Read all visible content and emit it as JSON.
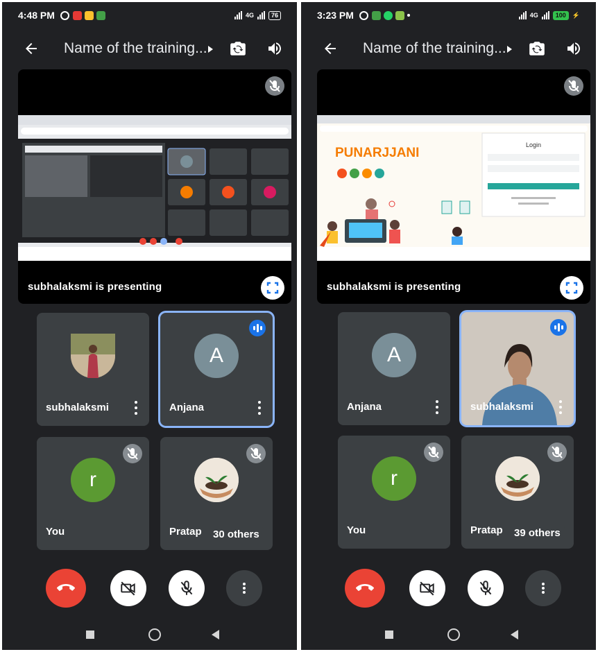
{
  "left": {
    "status": {
      "time": "4:48 PM",
      "network": "4G",
      "battery": "76"
    },
    "header": {
      "title": "Name of the training..."
    },
    "presentation": {
      "presenter_text": "subhalaksmi is presenting"
    },
    "tiles": [
      {
        "name": "subhalaksmi"
      },
      {
        "name": "Anjana",
        "initial": "A"
      },
      {
        "name": "You",
        "initial": "r"
      },
      {
        "name": "Pratap",
        "others": "30 others"
      }
    ]
  },
  "right": {
    "status": {
      "time": "3:23 PM",
      "network": "4G",
      "battery": "100"
    },
    "header": {
      "title": "Name of the training..."
    },
    "presentation": {
      "presenter_text": "subhalaksmi is presenting",
      "brand": "PUNARJJANI",
      "login_heading": "Login"
    },
    "tiles": [
      {
        "name": "Anjana",
        "initial": "A"
      },
      {
        "name": "subhalaksmi"
      },
      {
        "name": "You",
        "initial": "r"
      },
      {
        "name": "Pratap",
        "others": "39 others"
      }
    ]
  },
  "colors": {
    "background": "#202124",
    "tile": "#3c4043",
    "end_call": "#ea4335",
    "active_border": "#8ab4f8",
    "speaking": "#1a73e8",
    "avatar_grey": "#7a8f98",
    "avatar_green": "#5b9a32"
  }
}
